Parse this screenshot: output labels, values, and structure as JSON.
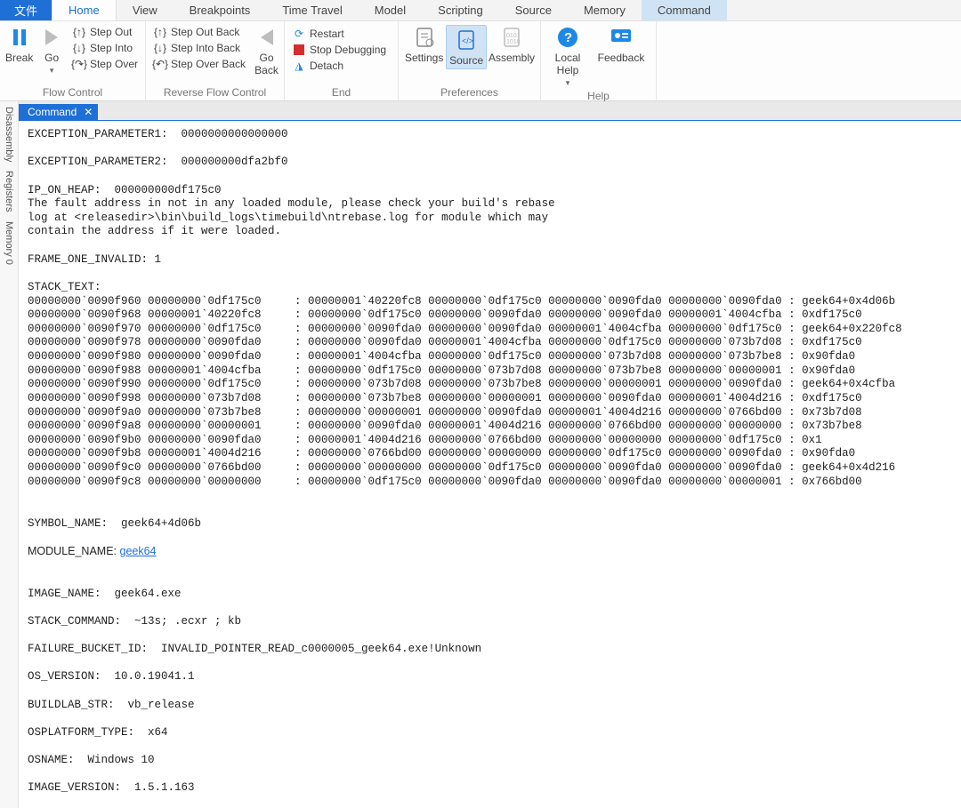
{
  "tabs": {
    "file": "文件",
    "items": [
      "Home",
      "View",
      "Breakpoints",
      "Time Travel",
      "Model",
      "Scripting",
      "Source",
      "Memory",
      "Command"
    ],
    "active": "Home",
    "highlight": "Command"
  },
  "ribbon": {
    "flow": {
      "break": "Break",
      "go": "Go",
      "step_out": "Step Out",
      "step_into": "Step Into",
      "step_over": "Step Over",
      "label": "Flow Control"
    },
    "reverse": {
      "step_out_back": "Step Out Back",
      "step_into_back": "Step Into Back",
      "step_over_back": "Step Over Back",
      "go_back": "Go\nBack",
      "label": "Reverse Flow Control"
    },
    "end": {
      "restart": "Restart",
      "stop": "Stop Debugging",
      "detach": "Detach",
      "label": "End"
    },
    "prefs": {
      "settings": "Settings",
      "source": "Source",
      "assembly": "Assembly",
      "label": "Preferences"
    },
    "help": {
      "local_help": "Local\nHelp",
      "feedback": "Feedback",
      "label": "Help"
    }
  },
  "panel": {
    "title": "Command"
  },
  "sidebar": [
    "Disassembly",
    "Registers",
    "Memory 0"
  ],
  "output": {
    "excp1": "EXCEPTION_PARAMETER1:  0000000000000000",
    "excp2": "EXCEPTION_PARAMETER2:  000000000dfa2bf0",
    "ip_on_heap": "IP_ON_HEAP:  000000000df175c0",
    "ip_msg": "The fault address in not in any loaded module, please check your build's rebase\nlog at <releasedir>\\bin\\build_logs\\timebuild\\ntrebase.log for module which may\ncontain the address if it were loaded.",
    "frame_one": "FRAME_ONE_INVALID: 1",
    "stack_header": "STACK_TEXT:  ",
    "stack": [
      "00000000`0090f960 00000000`0df175c0     : 00000001`40220fc8 00000000`0df175c0 00000000`0090fda0 00000000`0090fda0 : geek64+0x4d06b",
      "00000000`0090f968 00000001`40220fc8     : 00000000`0df175c0 00000000`0090fda0 00000000`0090fda0 00000001`4004cfba : 0xdf175c0",
      "00000000`0090f970 00000000`0df175c0     : 00000000`0090fda0 00000000`0090fda0 00000001`4004cfba 00000000`0df175c0 : geek64+0x220fc8",
      "00000000`0090f978 00000000`0090fda0     : 00000000`0090fda0 00000001`4004cfba 00000000`0df175c0 00000000`073b7d08 : 0xdf175c0",
      "00000000`0090f980 00000000`0090fda0     : 00000001`4004cfba 00000000`0df175c0 00000000`073b7d08 00000000`073b7be8 : 0x90fda0",
      "00000000`0090f988 00000001`4004cfba     : 00000000`0df175c0 00000000`073b7d08 00000000`073b7be8 00000000`00000001 : 0x90fda0",
      "00000000`0090f990 00000000`0df175c0     : 00000000`073b7d08 00000000`073b7be8 00000000`00000001 00000000`0090fda0 : geek64+0x4cfba",
      "00000000`0090f998 00000000`073b7d08     : 00000000`073b7be8 00000000`00000001 00000000`0090fda0 00000001`4004d216 : 0xdf175c0",
      "00000000`0090f9a0 00000000`073b7be8     : 00000000`00000001 00000000`0090fda0 00000001`4004d216 00000000`0766bd00 : 0x73b7d08",
      "00000000`0090f9a8 00000000`00000001     : 00000000`0090fda0 00000001`4004d216 00000000`0766bd00 00000000`00000000 : 0x73b7be8",
      "00000000`0090f9b0 00000000`0090fda0     : 00000001`4004d216 00000000`0766bd00 00000000`00000000 00000000`0df175c0 : 0x1",
      "00000000`0090f9b8 00000001`4004d216     : 00000000`0766bd00 00000000`00000000 00000000`0df175c0 00000000`0090fda0 : 0x90fda0",
      "00000000`0090f9c0 00000000`0766bd00     : 00000000`00000000 00000000`0df175c0 00000000`0090fda0 00000000`0090fda0 : geek64+0x4d216",
      "00000000`0090f9c8 00000000`00000000     : 00000000`0df175c0 00000000`0090fda0 00000000`0090fda0 00000000`00000001 : 0x766bd00"
    ],
    "symbol_name": "SYMBOL_NAME:  geek64+4d06b",
    "module_name_label": "MODULE_NAME: ",
    "module_name_link": "geek64",
    "image_name": "IMAGE_NAME:  geek64.exe",
    "stack_command": "STACK_COMMAND:  ~13s; .ecxr ; kb",
    "failure_bucket": "FAILURE_BUCKET_ID:  INVALID_POINTER_READ_c0000005_geek64.exe!Unknown",
    "os_version": "OS_VERSION:  10.0.19041.1",
    "buildlab": "BUILDLAB_STR:  vb_release",
    "osplatform": "OSPLATFORM_TYPE:  x64",
    "osname": "OSNAME:  Windows 10",
    "image_version": "IMAGE_VERSION:  1.5.1.163"
  }
}
